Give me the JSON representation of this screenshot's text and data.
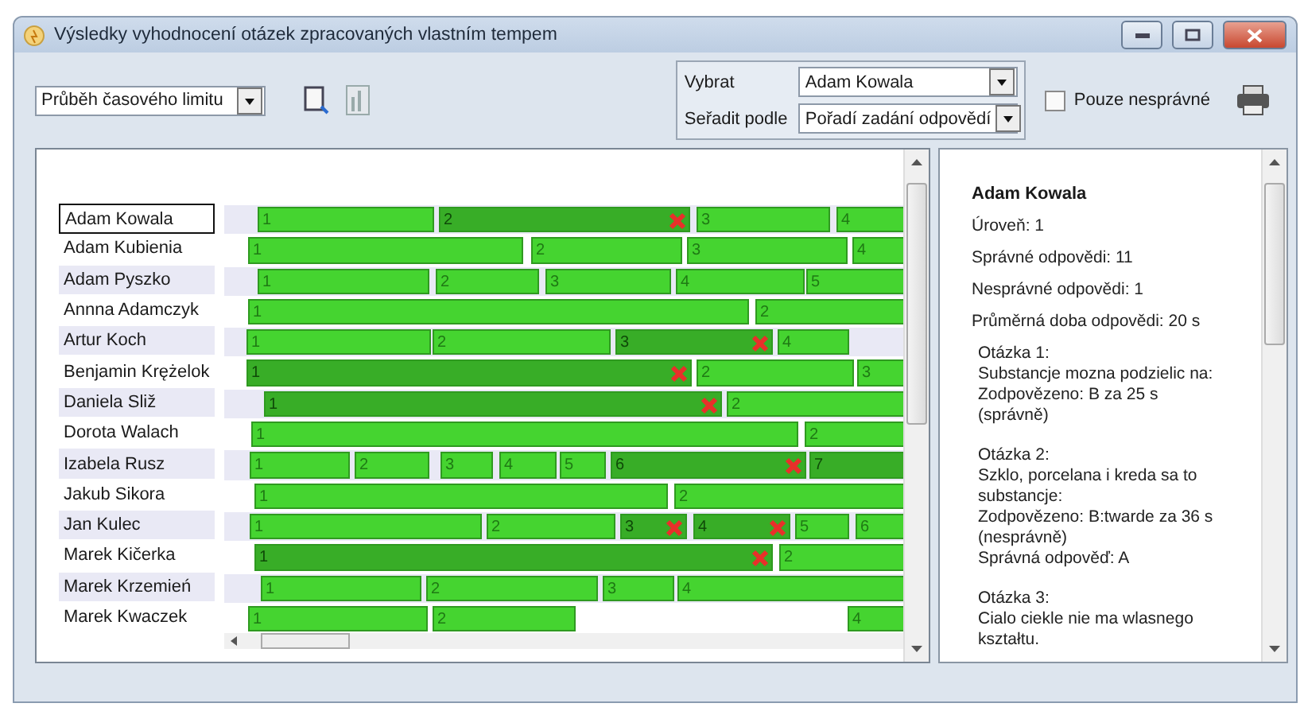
{
  "window": {
    "title": "Výsledky vyhodnocení otázek zpracovaných vlastním tempem"
  },
  "toolbar": {
    "view_select": "Průběh časového limitu",
    "select_label": "Vybrat",
    "select_value": "Adam Kowala",
    "sort_label": "Seřadit podle",
    "sort_value": "Pořadí zadání odpovědí",
    "only_wrong": {
      "label": "Pouze nesprávné",
      "checked": false
    }
  },
  "rows": [
    {
      "name": "Adam Kowala",
      "selected": true,
      "segments": [
        {
          "label": "1",
          "wrong": false
        },
        {
          "label": "2",
          "wrong": true
        },
        {
          "label": "3",
          "wrong": false
        },
        {
          "label": "4",
          "wrong": false
        }
      ]
    },
    {
      "name": "Adam Kubienia",
      "selected": false,
      "segments": [
        {
          "label": "1",
          "wrong": false
        },
        {
          "label": "2",
          "wrong": false
        },
        {
          "label": "3",
          "wrong": false
        },
        {
          "label": "4",
          "wrong": false
        }
      ]
    },
    {
      "name": "Adam Pyszko",
      "selected": false,
      "segments": [
        {
          "label": "1",
          "wrong": false
        },
        {
          "label": "2",
          "wrong": false
        },
        {
          "label": "3",
          "wrong": false
        },
        {
          "label": "4",
          "wrong": false
        },
        {
          "label": "5",
          "wrong": false
        }
      ]
    },
    {
      "name": "Annna Adamczyk",
      "selected": false,
      "segments": [
        {
          "label": "1",
          "wrong": false
        },
        {
          "label": "2",
          "wrong": false
        }
      ]
    },
    {
      "name": "Artur Koch",
      "selected": false,
      "segments": [
        {
          "label": "1",
          "wrong": false
        },
        {
          "label": "2",
          "wrong": false
        },
        {
          "label": "3",
          "wrong": true
        },
        {
          "label": "4",
          "wrong": false
        }
      ]
    },
    {
      "name": "Benjamin Krężelok",
      "selected": false,
      "segments": [
        {
          "label": "1",
          "wrong": true
        },
        {
          "label": "2",
          "wrong": false
        },
        {
          "label": "3",
          "wrong": false
        }
      ]
    },
    {
      "name": "Daniela Sliž",
      "selected": false,
      "segments": [
        {
          "label": "1",
          "wrong": true
        },
        {
          "label": "2",
          "wrong": false
        }
      ]
    },
    {
      "name": "Dorota Walach",
      "selected": false,
      "segments": [
        {
          "label": "1",
          "wrong": false
        },
        {
          "label": "2",
          "wrong": false
        }
      ]
    },
    {
      "name": "Izabela Rusz",
      "selected": false,
      "segments": [
        {
          "label": "1",
          "wrong": false
        },
        {
          "label": "2",
          "wrong": false
        },
        {
          "label": "3",
          "wrong": false
        },
        {
          "label": "4",
          "wrong": false
        },
        {
          "label": "5",
          "wrong": false
        },
        {
          "label": "6",
          "wrong": true
        },
        {
          "label": "7",
          "wrong": true
        }
      ]
    },
    {
      "name": "Jakub Sikora",
      "selected": false,
      "segments": [
        {
          "label": "1",
          "wrong": false
        },
        {
          "label": "2",
          "wrong": false
        }
      ]
    },
    {
      "name": "Jan Kulec",
      "selected": false,
      "segments": [
        {
          "label": "1",
          "wrong": false
        },
        {
          "label": "2",
          "wrong": false
        },
        {
          "label": "3",
          "wrong": true
        },
        {
          "label": "4",
          "wrong": true
        },
        {
          "label": "5",
          "wrong": false
        },
        {
          "label": "6",
          "wrong": false
        }
      ]
    },
    {
      "name": "Marek Kičerka",
      "selected": false,
      "segments": [
        {
          "label": "1",
          "wrong": true
        },
        {
          "label": "2",
          "wrong": false
        }
      ]
    },
    {
      "name": "Marek Krzemień",
      "selected": false,
      "segments": [
        {
          "label": "1",
          "wrong": false
        },
        {
          "label": "2",
          "wrong": false
        },
        {
          "label": "3",
          "wrong": false
        },
        {
          "label": "4",
          "wrong": false
        }
      ]
    },
    {
      "name": "Marek Kwaczek",
      "selected": false,
      "segments": [
        {
          "label": "1",
          "wrong": false
        },
        {
          "label": "2",
          "wrong": false
        },
        {
          "label": "4",
          "wrong": false
        }
      ]
    }
  ],
  "detail": {
    "name": "Adam Kowala",
    "stats": [
      "Úroveň: 1",
      "Správné odpovědi: 11",
      "Nesprávné odpovědi: 1",
      "Průměrná doba odpovědi: 20 s"
    ],
    "questions": [
      {
        "lines": [
          "Otázka 1:",
          "Substancje mozna podzielic na:",
          "Zodpovězeno: B za 25 s",
          "(správně)"
        ]
      },
      {
        "lines": [
          "Otázka 2:",
          "Szklo, porcelana i kreda sa to substancje:",
          "Zodpovězeno: B:twarde za 36 s",
          "(nesprávně)",
          "Správná odpověď: A"
        ]
      },
      {
        "lines": [
          "Otázka 3:",
          "Cialo ciekle nie ma wlasnego kształtu."
        ]
      }
    ]
  }
}
